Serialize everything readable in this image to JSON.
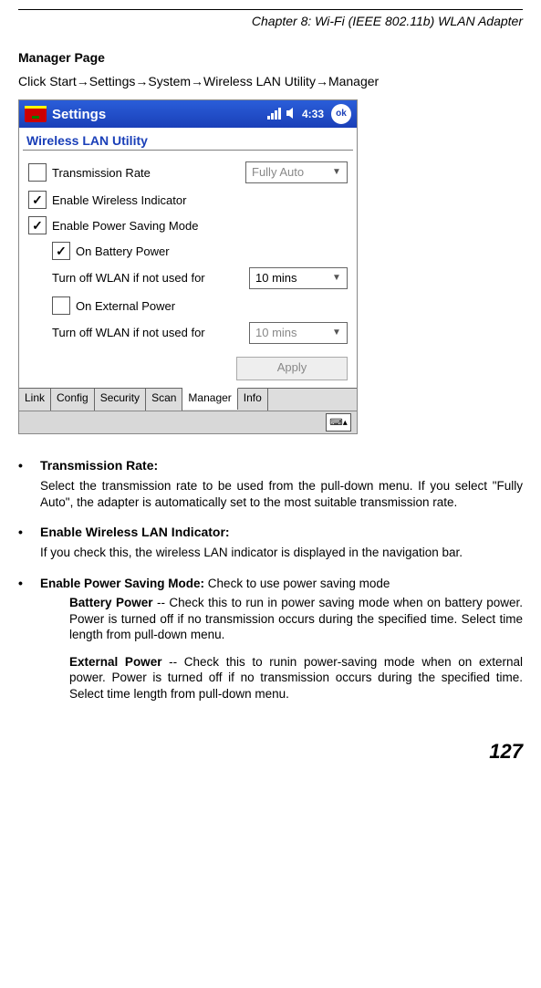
{
  "chapter": "Chapter 8: Wi-Fi (IEEE 802.11b) WLAN Adapter",
  "section_title": "Manager Page",
  "nav_path": "Click Start→Settings→System→Wireless LAN Utility→Manager",
  "screenshot": {
    "titlebar": "Settings",
    "clock": "4:33",
    "ok": "ok",
    "app_title": "Wireless LAN Utility",
    "transmission_rate_label": "Transmission Rate",
    "transmission_rate_value": "Fully Auto",
    "enable_indicator": "Enable Wireless Indicator",
    "enable_psm": "Enable Power Saving Mode",
    "on_battery": "On Battery Power",
    "turnoff_label": "Turn off WLAN if not used for",
    "turnoff_value": "10 mins",
    "on_external": "On External Power",
    "turnoff2_value": "10 mins",
    "apply": "Apply",
    "tabs": [
      "Link",
      "Config",
      "Security",
      "Scan",
      "Manager",
      "Info"
    ]
  },
  "bullets": {
    "b1_title": "Transmission Rate:",
    "b1_body": "Select the transmission rate to be used from the pull-down menu. If you select \"Fully Auto\", the adapter is automatically set to the most suitable transmission rate.",
    "b2_title": "Enable Wireless LAN Indicator:",
    "b2_body": "If you check  this, the wireless LAN indicator is displayed in the navigation bar.",
    "b3_title": "Enable Power Saving Mode:",
    "b3_afterTitle": " Check to use power saving mode",
    "b3_sub1_lead": "Battery Power",
    "b3_sub1": " -- Check this to run in power saving mode when on battery power. Power is turned off if no transmission occurs during the specified time. Select time length from pull-down menu.",
    "b3_sub2_lead": "External Power",
    "b3_sub2": " -- Check this to runin power-saving mode when on external power. Power is turned off if no transmission occurs during the specified time. Select time length from pull-down menu."
  },
  "pagenum": "127"
}
